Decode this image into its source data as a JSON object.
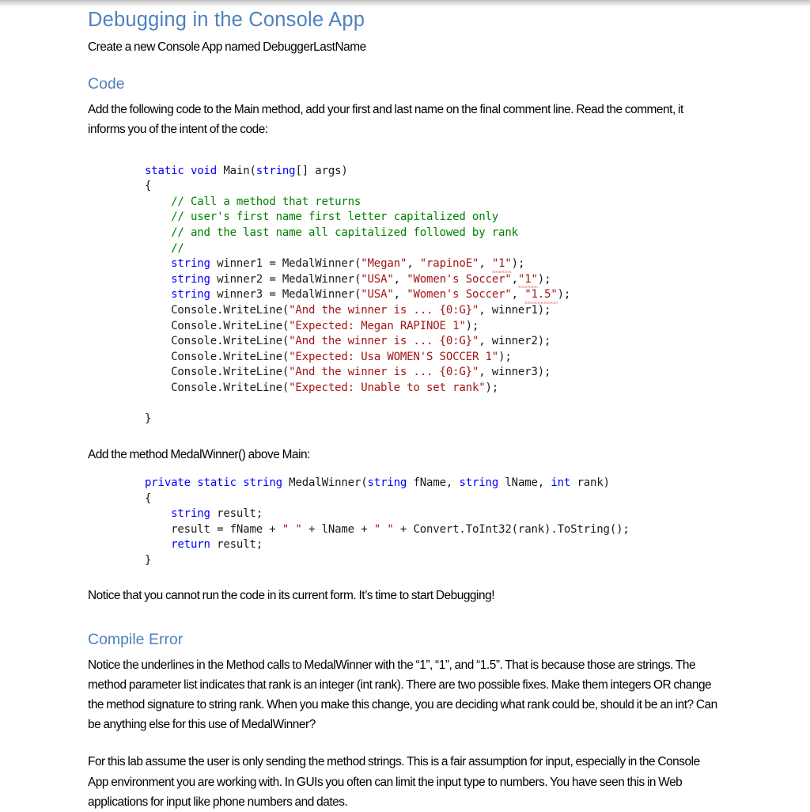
{
  "document": {
    "title": "Debugging in the Console App",
    "intro": "Create a new Console App named DebuggerLastName",
    "sections": {
      "code": {
        "heading": "Code",
        "paragraph": "Add the following code to the Main method, add your first and last name on the final comment line. Read the comment, it informs you of the intent of the code:",
        "method_intro": "Add the method MedalWinner() above Main:",
        "closing_note": "Notice that you cannot run the code in its current form. It’s time to start Debugging!"
      },
      "compile_error": {
        "heading": "Compile Error",
        "paragraph1": "Notice the underlines in the Method calls to MedalWinner with the “1”, “1”, and “1.5”. That is because those are strings. The method parameter list indicates that rank is an integer (int rank). There are two possible fixes. Make them integers OR change the method signature to string rank.  When you make this change, you are deciding what rank could be, should it be an int? Can be anything else for this use of MedalWinner?",
        "paragraph2": "For this lab assume the user is only sending the method strings. This is a fair assumption for input, especially in the Console App environment you are working with. In GUIs you often can limit the input type to numbers. You have seen this in Web applications for input like phone numbers and dates."
      }
    }
  },
  "code_blocks": {
    "main_method": {
      "language": "csharp",
      "lines": [
        "static void Main(string[] args)",
        "{",
        "    // Call a method that returns",
        "    // user's first name first letter capitalized only",
        "    // and the last name all capitalized followed by rank",
        "    //",
        "    string winner1 = MedalWinner(\"Megan\", \"rapinoE\", \"1\");",
        "    string winner2 = MedalWinner(\"USA\", \"Women's Soccer\",\"1\");",
        "    string winner3 = MedalWinner(\"USA\", \"Women's Soccer\", \"1.5\");",
        "    Console.WriteLine(\"And the winner is ... {0:G}\", winner1);",
        "    Console.WriteLine(\"Expected: Megan RAPINOE 1\");",
        "    Console.WriteLine(\"And the winner is ... {0:G}\", winner2);",
        "    Console.WriteLine(\"Expected: Usa WOMEN'S SOCCER 1\");",
        "    Console.WriteLine(\"And the winner is ... {0:G}\", winner3);",
        "    Console.WriteLine(\"Expected: Unable to set rank\");",
        "",
        "}"
      ]
    },
    "medal_winner_method": {
      "language": "csharp",
      "lines": [
        "private static string MedalWinner(string fName, string lName, int rank)",
        "{",
        "    string result;",
        "    result = fName + \" \" + lName + \" \" + Convert.ToInt32(rank).ToString();",
        "    return result;",
        "}"
      ]
    }
  },
  "syntax_colors": {
    "keyword": "#0000ff",
    "comment": "#008000",
    "string": "#a31515",
    "plain": "#1a1a1a",
    "heading": "#4f81bd",
    "error_underline": "#d03030"
  },
  "tokens": {
    "kw_static": "static",
    "kw_void": "void",
    "kw_string": "string",
    "kw_private": "private",
    "kw_int": "int",
    "kw_return": "return",
    "main_sig_name": " Main(",
    "main_sig_tail": "[] args)",
    "brace_open": "{",
    "brace_close": "}",
    "comment1": "    // Call a method that returns",
    "comment2": "    // user's first name first letter capitalized only",
    "comment3": "    // and the last name all capitalized followed by rank",
    "comment4": "    //",
    "w1_pre": " winner1 = MedalWinner(",
    "w1_s1": "\"Megan\"",
    "w1_mid": ", ",
    "w1_s2": "\"rapinoE\"",
    "w1_s3": "\"1\"",
    "w1_end": ");",
    "w2_pre": " winner2 = MedalWinner(",
    "w2_s1": "\"USA\"",
    "w2_s2": "\"Women's Soccer\"",
    "w2_comma": ",",
    "w2_s3": "\"1\"",
    "w2_end": ");",
    "w3_pre": " winner3 = MedalWinner(",
    "w3_s1": "\"USA\"",
    "w3_s2": "\"Women's Soccer\"",
    "w3_s3": "\"1.5\"",
    "w3_end": ");",
    "cw_pre": "    Console.WriteLine(",
    "cw1_str": "\"And the winner is ... {0:G}\"",
    "cw1_tail": ", winner1);",
    "cw2_str": "\"Expected: Megan RAPINOE 1\"",
    "cw2_tail": ");",
    "cw3_str": "\"And the winner is ... {0:G}\"",
    "cw3_tail": ", winner2);",
    "cw4_str": "\"Expected: Usa WOMEN'S SOCCER 1\"",
    "cw4_tail": ");",
    "cw5_str": "\"And the winner is ... {0:G}\"",
    "cw5_tail": ", winner3);",
    "cw6_str": "\"Expected: Unable to set rank\"",
    "cw6_tail": ");",
    "mw_name": " MedalWinner(",
    "mw_p1": " fName, ",
    "mw_p2": " lName, ",
    "mw_p3": " rank)",
    "res_decl": " result;",
    "res_line_pre": "    result = fName + ",
    "res_q1": "\" \"",
    "res_mid": " + lName + ",
    "res_q2": "\" \"",
    "res_tail": " + Convert.ToInt32(rank).ToString();",
    "ret_val": " result;",
    "indent4": "    "
  }
}
